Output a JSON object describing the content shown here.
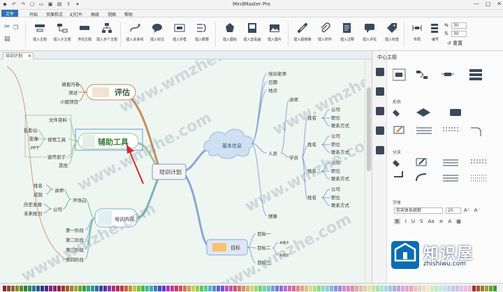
{
  "titlebar": {
    "title": "MindMaster Pro",
    "window_controls": [
      "—",
      "□",
      "✕"
    ]
  },
  "menubar": {
    "tabs": [
      "文件",
      "开始",
      "页面样式",
      "幻灯片",
      "高级",
      "视图",
      "帮助"
    ],
    "active": "文件"
  },
  "ribbon": {
    "groups": [
      {
        "label": "插入主题"
      },
      {
        "label": "插入子主题"
      },
      {
        "label": "浮动主题"
      },
      {
        "label": "插入多个主题"
      },
      {
        "label": "插入关系线"
      },
      {
        "label": "插入标注"
      },
      {
        "label": "插入外框"
      },
      {
        "label": "插入概要"
      },
      {
        "label": "插入图标"
      },
      {
        "label": "插入剪贴画"
      },
      {
        "label": "插入图片"
      },
      {
        "label": "插入超链接"
      },
      {
        "label": "插入附件"
      },
      {
        "label": "插入注释"
      },
      {
        "label": "插入评论"
      },
      {
        "label": "插入标签"
      },
      {
        "label": "布局"
      },
      {
        "label": "编号"
      },
      {
        "label": "重置"
      }
    ],
    "spacing_h": "30",
    "spacing_v": "30"
  },
  "doc_tab": "培训计划",
  "mindmap": {
    "center": "培训计划",
    "branches": {
      "evaluate": {
        "label": "评估",
        "items": [
          "调查问卷",
          "测试",
          "小组项目"
        ]
      },
      "tools": {
        "label": "辅助工具",
        "items": [
          "文件资料",
          "视觉工具",
          "宣传册子",
          "其他"
        ],
        "visual_sub": [
          "投影仪",
          "影像",
          "PPT"
        ]
      },
      "content": {
        "label": "培训内容",
        "items": [
          "开场白",
          "第一阶段",
          "第二阶段",
          "第三阶段",
          "第四阶段"
        ],
        "opening_sub": [
          "讲师",
          "公司"
        ],
        "lecturer_sub": [
          "姓名",
          "成就"
        ],
        "company_sub": [
          "历史发展",
          "未来规划"
        ]
      },
      "basic": {
        "label": "基本信息",
        "items": [
          "培训老师",
          "日期",
          "地点",
          "人员",
          "预算"
        ]
      },
      "people": {
        "label": "人员",
        "items": [
          "讲师",
          "学员"
        ],
        "trainees": [
          {
            "name": "姓名",
            "fields": [
              "公司",
              "职位",
              "联系方式"
            ]
          },
          {
            "name": "姓名",
            "fields": [
              "公司",
              "职位",
              "联系方式"
            ]
          },
          {
            "name": "姓名",
            "fields": [
              "公司",
              "职位",
              "联系方式"
            ]
          },
          {
            "name": "姓名",
            "fields": [
              "公司",
              "职位",
              "联系方式"
            ]
          }
        ]
      },
      "goals": {
        "label": "目标",
        "items": [
          "目标一",
          "目标二",
          "目标三"
        ],
        "goal2_sub": [
          "关键点",
          "关键点"
        ]
      }
    }
  },
  "right_panel": {
    "title": "中心主题",
    "sections": [
      "形状",
      "分支",
      "字体"
    ],
    "font_name": "仿宋体系统默",
    "font_size": "20"
  },
  "watermarks": [
    "www.wmzhe.com",
    "www.wmzhe.com",
    "www.wmzhe.com",
    "www.wmzhe.com",
    "www.wmzhe.com",
    "www.wmzhe.com"
  ],
  "badge": {
    "name": "知识屋",
    "url": "zhishiwu.com"
  },
  "colors": {
    "accent": "#2f6fb3",
    "canvas": "#eef6f1",
    "branch_brown": "#c98a5b",
    "branch_green": "#9cc79c",
    "branch_teal": "#7ab3b4",
    "branch_blue": "#8aa7d6",
    "arrow_red": "#d42a2a"
  }
}
